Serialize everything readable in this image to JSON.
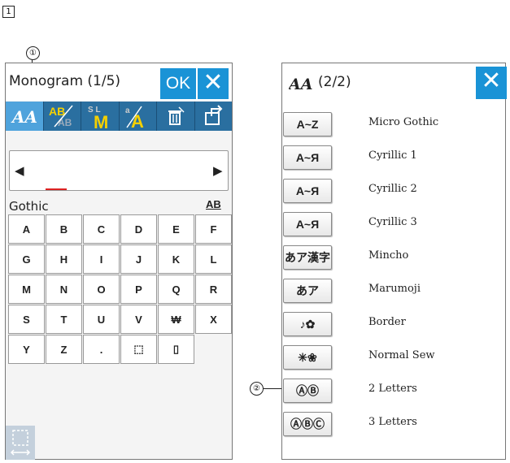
{
  "step_marker": "1",
  "callouts": [
    "①",
    "②"
  ],
  "left_panel": {
    "title": "Monogram (1/5)",
    "ok_label": "OK",
    "close_label": "✕",
    "toolbar_icons": [
      "font-select-icon",
      "ab-style-icon",
      "size-icon",
      "monogram-a-icon",
      "delete-icon",
      "save-icon"
    ],
    "arrow_left": "◀",
    "arrow_right": "▶",
    "font_name": "Gothic",
    "case_label": "AB",
    "keys": [
      "A",
      "B",
      "C",
      "D",
      "E",
      "F",
      "G",
      "H",
      "I",
      "J",
      "K",
      "L",
      "M",
      "N",
      "O",
      "P",
      "Q",
      "R",
      "S",
      "T",
      "U",
      "V",
      "₩",
      "X",
      "Y",
      "Z",
      ".",
      "⬚",
      "▯"
    ]
  },
  "right_panel": {
    "title": "(2/2)",
    "close_label": "✕",
    "fonts": [
      {
        "button": "A~Z",
        "label": "Micro Gothic"
      },
      {
        "button": "A~Я",
        "label": "Cyrillic 1"
      },
      {
        "button": "A~Я",
        "label": "Cyrillic 2"
      },
      {
        "button": "A~Я",
        "label": "Cyrillic 3"
      },
      {
        "button": "あア漢字",
        "label": "Mincho"
      },
      {
        "button": "あア",
        "label": "Marumoji"
      },
      {
        "button": "♪✿",
        "label": "Border"
      },
      {
        "button": "✳❀",
        "label": "Normal Sew"
      },
      {
        "button": "ⒶⒷ",
        "label": "2 Letters"
      },
      {
        "button": "ⒶⒷⒸ",
        "label": "3 Letters"
      }
    ]
  }
}
